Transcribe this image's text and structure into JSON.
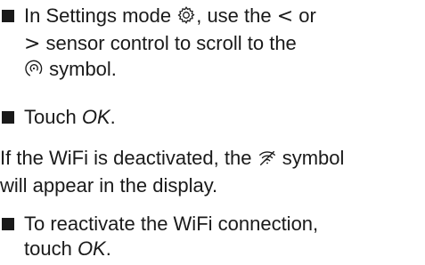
{
  "step1": {
    "line1": {
      "before": "In Settings mode ",
      "after": ", use the "
    },
    "lt_char": "<",
    "or_text": " or",
    "gt_char": ">",
    "line2_text": " sensor control to scroll to the",
    "line3_text": " symbol.",
    "settings_icon": "gear-icon",
    "wifi_icon": "wifi-icon"
  },
  "step2": {
    "before": "Touch ",
    "ok": "OK",
    "after": "."
  },
  "note": {
    "line1_before": "If the WiFi is deactivated, the ",
    "line1_after": " symbol",
    "line2": "will appear in the display.",
    "icon": "wifi-off-icon"
  },
  "step3": {
    "line1": "To reactivate the WiFi connection,",
    "line2_before": "touch ",
    "ok": "OK",
    "line2_after": "."
  }
}
